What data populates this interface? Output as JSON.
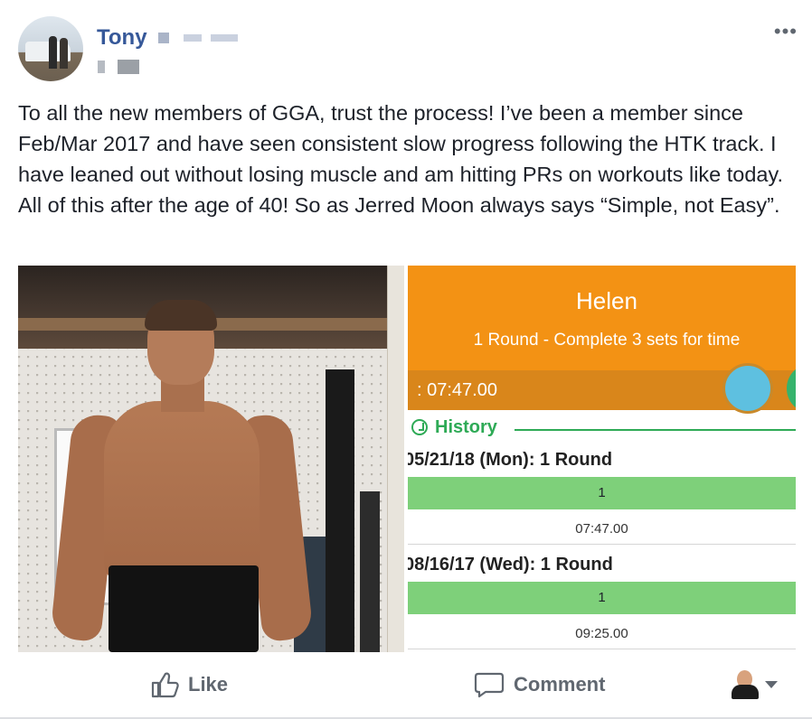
{
  "post": {
    "author_name": "Tony",
    "text": "To all the new members of GGA, trust the process! I’ve been a member since Feb/Mar 2017 and have seen consistent slow progress following the HTK track. I have leaned out without losing muscle and am hitting PRs on workouts like today. All of this after the age of 40! So as Jerred Moon always says “Simple, not Easy”.",
    "more_label": "•••"
  },
  "app_screen": {
    "title": "Helen",
    "subtitle": "1 Round - Complete 3 sets for time",
    "timer": ": 07:47.00",
    "history_label": "History",
    "entries": [
      {
        "date": "05/21/18 (Mon): 1 Round",
        "round": "1",
        "time": "07:47.00"
      },
      {
        "date": "08/16/17 (Wed): 1 Round",
        "round": "1",
        "time": "09:25.00"
      }
    ],
    "colors": {
      "header": "#f39214",
      "timer_bar": "#d9861b",
      "accent_green": "#2eaa56",
      "row_green": "#7ed07a",
      "circle_blue": "#5ec0e0"
    }
  },
  "actions": {
    "like_label": "Like",
    "comment_label": "Comment"
  },
  "icons": {
    "like": "thumbs-up-icon",
    "comment": "speech-bubble-icon",
    "more": "ellipsis-icon",
    "caret": "caret-down-icon"
  },
  "colors": {
    "author_link": "#365899",
    "text": "#1d2129",
    "action_gray": "#606770"
  }
}
